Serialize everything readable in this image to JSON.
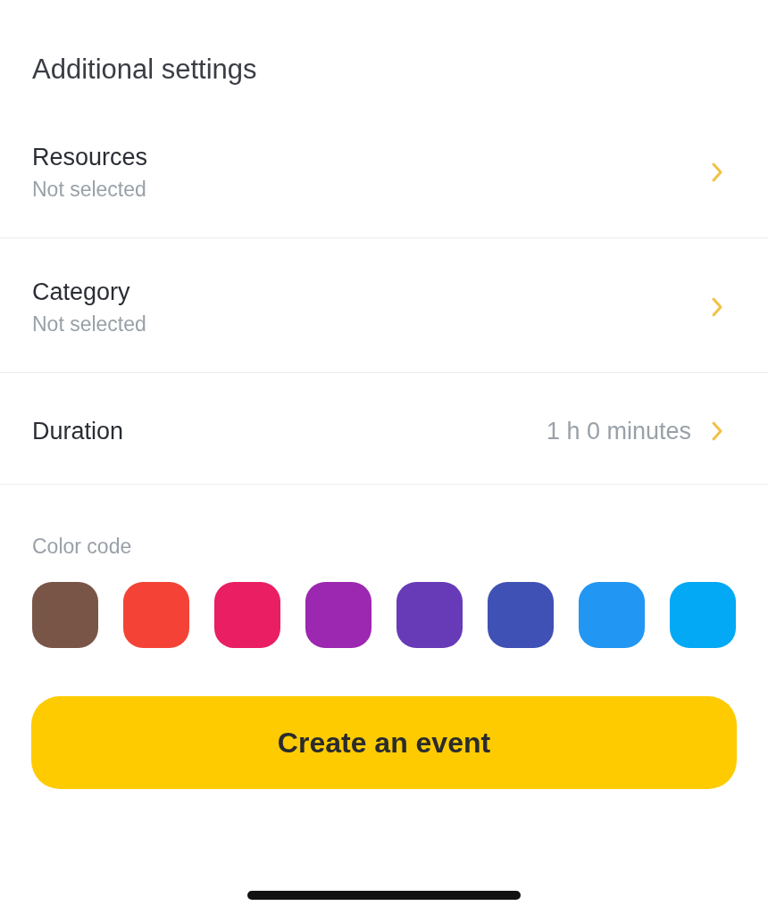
{
  "section_title": "Additional settings",
  "rows": [
    {
      "kind": "subtitle",
      "label": "Resources",
      "detail": "Not selected"
    },
    {
      "kind": "subtitle",
      "label": "Category",
      "detail": "Not selected"
    },
    {
      "kind": "value",
      "label": "Duration",
      "detail": "1 h 0 minutes"
    }
  ],
  "color_code": {
    "label": "Color code",
    "swatches": [
      {
        "color": "#795548"
      },
      {
        "color": "#f44336"
      },
      {
        "color": "#e91e63"
      },
      {
        "color": "#9c27b0"
      },
      {
        "color": "#673ab7"
      },
      {
        "color": "#3f51b5"
      },
      {
        "color": "#2196f3"
      },
      {
        "color": "#03a9f4"
      }
    ]
  },
  "button": "Create an event"
}
